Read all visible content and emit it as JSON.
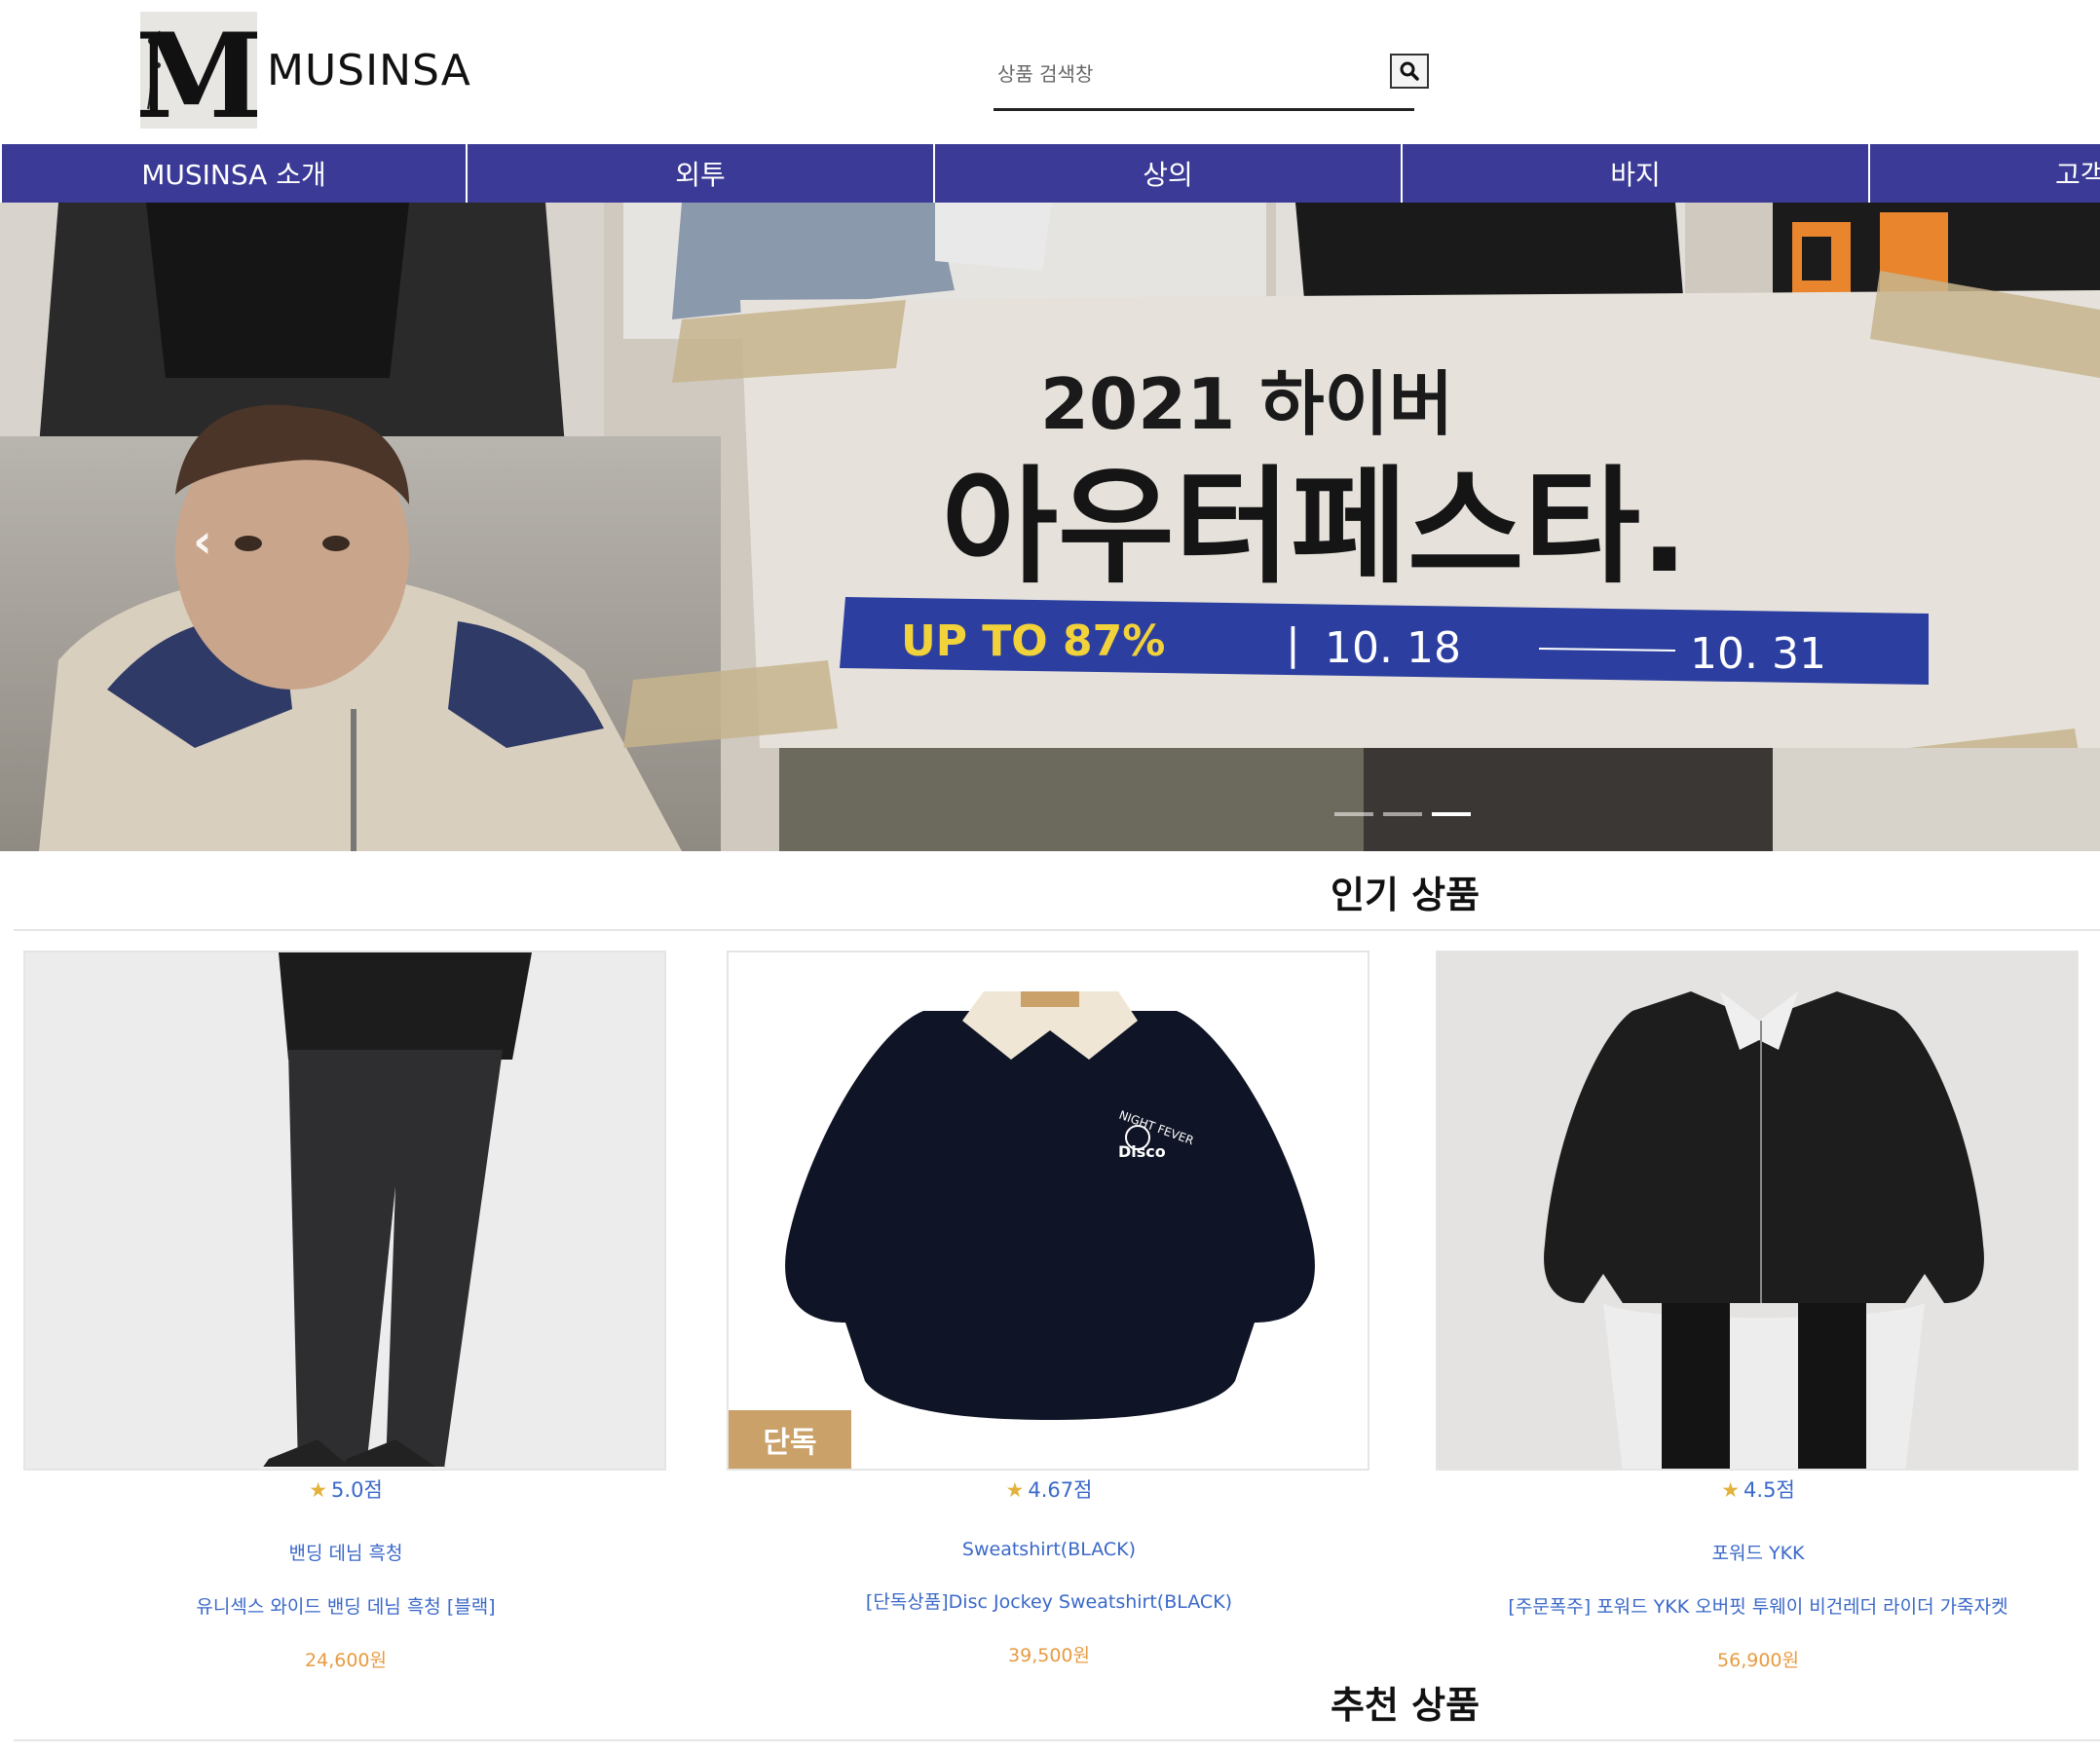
{
  "header": {
    "logo_letter": "M",
    "logo_text": "MUSINSA",
    "search_placeholder": "상품 검색창"
  },
  "nav": {
    "items": [
      {
        "label": "MUSINSA 소개"
      },
      {
        "label": "외투"
      },
      {
        "label": "상의"
      },
      {
        "label": "바지"
      },
      {
        "label": "고객"
      }
    ]
  },
  "banner": {
    "headline_small": "2021 하이버",
    "headline_large": "아우터페스타.",
    "promo": "UP TO 87%",
    "period_start": "10. 18",
    "period_end": "10. 31",
    "slide_count": 3,
    "active_slide": 3
  },
  "sections": {
    "popular_title": "인기 상품",
    "recommended_title": "추천 상품"
  },
  "products": [
    {
      "rating": "5.0점",
      "brand": "밴딩 데님 흑청",
      "name": "유니섹스 와이드 밴딩 데님 흑청 [블랙]",
      "price": "24,600원"
    },
    {
      "rating": "4.67점",
      "brand": "Sweatshirt(BLACK)",
      "name": "[단독상품]Disc Jockey Sweatshirt(BLACK)",
      "price": "39,500원",
      "badge": "단독",
      "print_top": "NIGHT FEVER",
      "print_bottom": "Disco"
    },
    {
      "rating": "4.5점",
      "brand": "포워드 YKK",
      "name": "[주문폭주] 포워드 YKK 오버핏 투웨이 비건레더 라이더 가죽자켓",
      "price": "56,900원"
    }
  ],
  "colors": {
    "nav_bg": "#3b3a96",
    "link_blue": "#3a68c9",
    "price_orange": "#e89b40",
    "star_gold": "#e2b23a",
    "badge_tan": "#c9a169",
    "promo_bar": "#2c3fa0",
    "promo_yellow": "#f2d23a"
  }
}
